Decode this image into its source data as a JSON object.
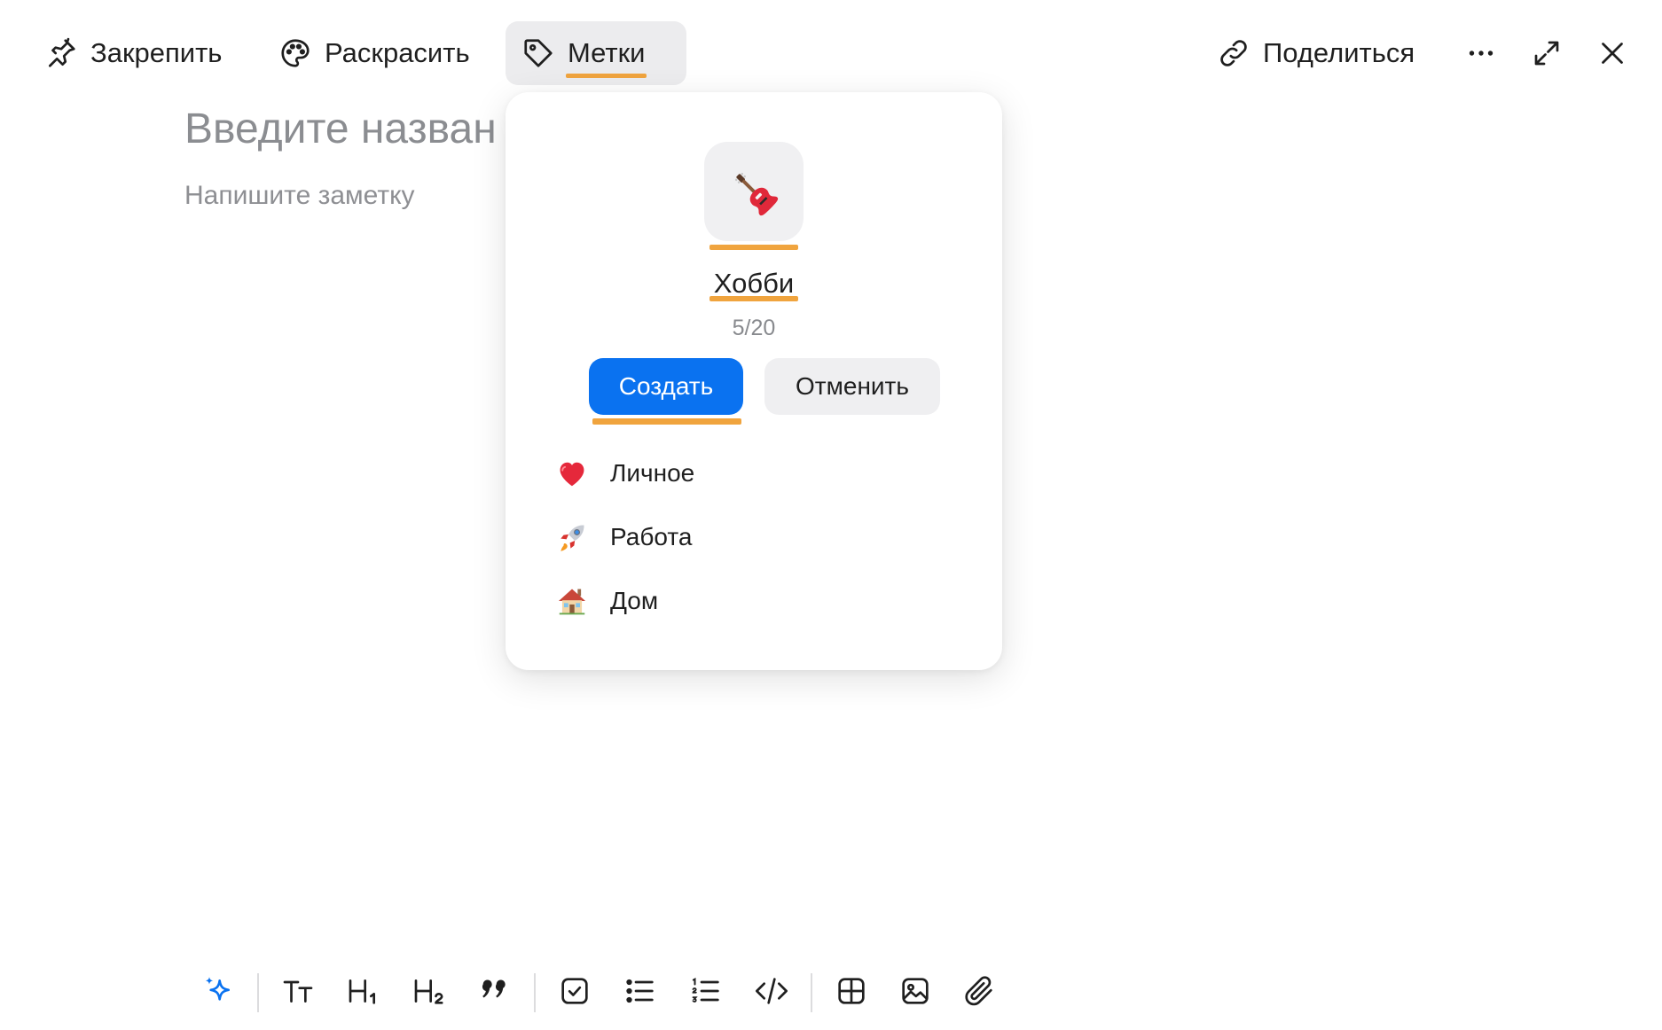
{
  "toolbar": {
    "pin_label": "Закрепить",
    "color_label": "Раскрасить",
    "tags_label": "Метки",
    "share_label": "Поделиться"
  },
  "note": {
    "title_placeholder": "Введите назван",
    "body_placeholder": "Напишите заметку"
  },
  "tag_popover": {
    "new_tag_emoji": "guitar-icon",
    "new_tag_name": "Хобби",
    "counter": "5/20",
    "create_label": "Создать",
    "cancel_label": "Отменить",
    "existing_tags": [
      {
        "emoji": "heart-icon",
        "label": "Личное"
      },
      {
        "emoji": "rocket-icon",
        "label": "Работа"
      },
      {
        "emoji": "house-icon",
        "label": "Дом"
      }
    ]
  },
  "colors": {
    "accent": "#0a72f0",
    "highlight": "#f0a43e",
    "muted_text": "#8b8d91"
  },
  "format_toolbar": [
    "sparkle-icon",
    "text-size-icon",
    "heading-1-icon",
    "heading-2-icon",
    "quote-icon",
    "checkbox-icon",
    "bullet-list-icon",
    "numbered-list-icon",
    "code-icon",
    "table-icon",
    "image-icon",
    "attachment-icon"
  ]
}
